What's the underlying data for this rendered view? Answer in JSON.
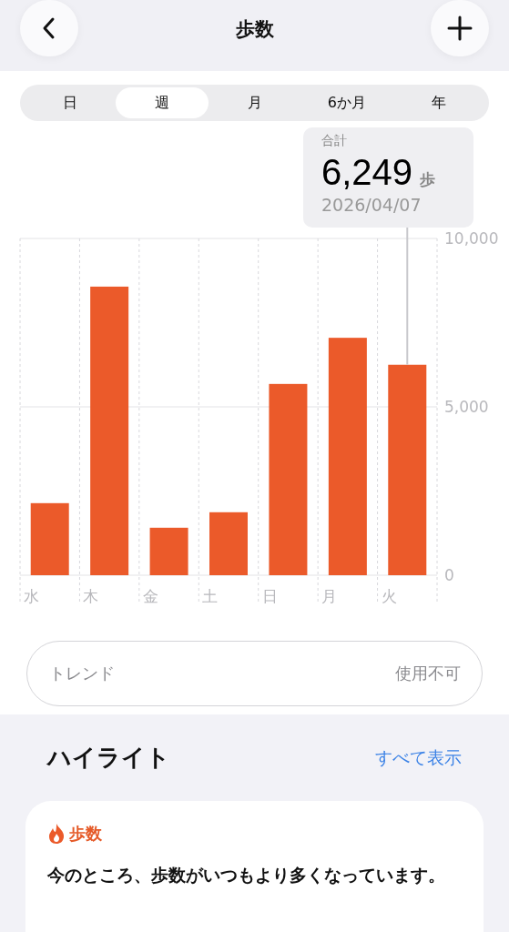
{
  "header": {
    "title": "歩数"
  },
  "tabs": [
    {
      "label": "日",
      "selected": false
    },
    {
      "label": "週",
      "selected": true
    },
    {
      "label": "月",
      "selected": false
    },
    {
      "label": "6か月",
      "selected": false
    },
    {
      "label": "年",
      "selected": false
    }
  ],
  "chart": {
    "tooltip": {
      "label": "合計",
      "value": "6,249",
      "unit": "歩",
      "date": "2026/04/07"
    },
    "chart_data": {
      "type": "bar",
      "categories": [
        "水",
        "木",
        "金",
        "土",
        "日",
        "月",
        "火"
      ],
      "series": [
        {
          "color": "#eb5a2a",
          "values": [
            2140,
            8570,
            1410,
            1870,
            5680,
            7050,
            6250
          ]
        }
      ],
      "ylim": [
        0,
        10000
      ],
      "yticks": [
        {
          "value": 0,
          "label": "0"
        },
        {
          "value": 5000,
          "label": "5,000"
        },
        {
          "value": 10000,
          "label": "10,000"
        }
      ]
    }
  },
  "trend": {
    "label": "トレンド",
    "value": "使用不可"
  },
  "highlights": {
    "title": "ハイライト",
    "show_all": "すべて表示",
    "card": {
      "category": "歩数",
      "text": "今のところ、歩数がいつもより多くなっています。"
    }
  }
}
